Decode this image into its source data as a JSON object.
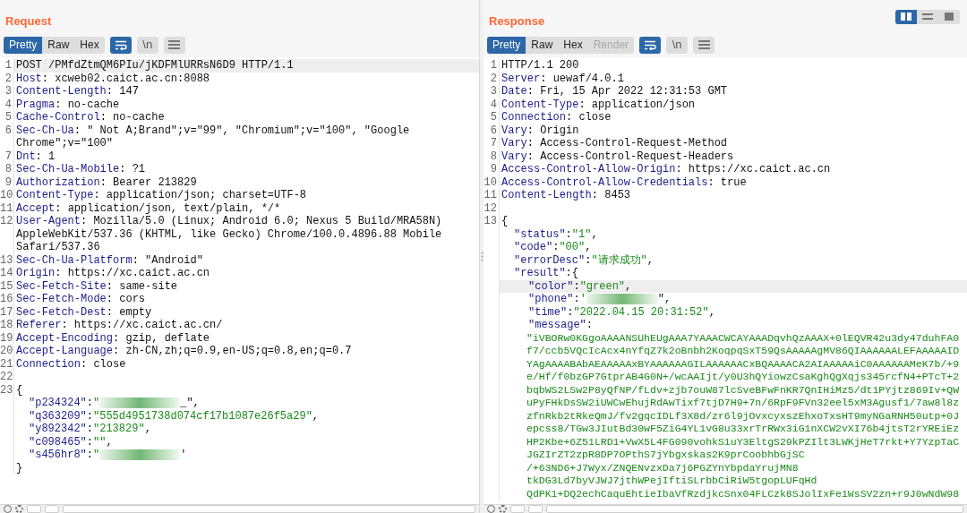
{
  "request": {
    "title": "Request",
    "view_tabs": [
      {
        "label": "Pretty",
        "selected": true,
        "disabled": false
      },
      {
        "label": "Raw",
        "selected": false,
        "disabled": false
      },
      {
        "label": "Hex",
        "selected": false,
        "disabled": false
      }
    ],
    "tools": [
      {
        "kind": "wrap",
        "selected": true
      },
      {
        "kind": "newline",
        "label": "\\n",
        "selected": false
      },
      {
        "kind": "menu",
        "selected": false
      }
    ],
    "lines": [
      {
        "num": "1",
        "kind": "plain",
        "text": "POST /PMfdZtmQM6PIu/jKDFMlURRsN6D9 HTTP/1.1",
        "highlighted": true
      },
      {
        "num": "2",
        "kind": "header",
        "name": "Host",
        "sep": ":",
        "value": "xcweb02.caict.ac.cn:8088",
        "highlighted": false
      },
      {
        "num": "3",
        "kind": "header",
        "name": "Content-Length",
        "sep": ":",
        "value": "147",
        "highlighted": false
      },
      {
        "num": "4",
        "kind": "header",
        "name": "Pragma",
        "sep": ":",
        "value": "no-cache",
        "highlighted": false
      },
      {
        "num": "5",
        "kind": "header",
        "name": "Cache-Control",
        "sep": ":",
        "value": "no-cache",
        "highlighted": false
      },
      {
        "num": "6",
        "kind": "header",
        "name": "Sec-Ch-Ua",
        "sep": ":",
        "value": "\" Not A;Brand\";v=\"99\", \"Chromium\";v=\"100\", \"Google Chrome\";v=\"100\"",
        "highlighted": false
      },
      {
        "num": "7",
        "kind": "header",
        "name": "Dnt",
        "sep": ":",
        "value": "1",
        "highlighted": false
      },
      {
        "num": "8",
        "kind": "header",
        "name": "Sec-Ch-Ua-Mobile",
        "sep": ":",
        "value": "?1",
        "highlighted": false
      },
      {
        "num": "9",
        "kind": "header",
        "name": "Authorization",
        "sep": ":",
        "value": "Bearer 213829",
        "highlighted": false
      },
      {
        "num": "10",
        "kind": "header",
        "name": "Content-Type",
        "sep": ":",
        "value": "application/json; charset=UTF-8",
        "highlighted": false
      },
      {
        "num": "11",
        "kind": "header",
        "name": "Accept",
        "sep": ":",
        "value": "application/json, text/plain, */*",
        "highlighted": false
      },
      {
        "num": "12",
        "kind": "header",
        "name": "User-Agent",
        "sep": ":",
        "value": "Mozilla/5.0 (Linux; Android 6.0; Nexus 5 Build/MRA58N) AppleWebKit/537.36 (KHTML, like Gecko) Chrome/100.0.4896.88 Mobile Safari/537.36",
        "highlighted": false
      },
      {
        "num": "13",
        "kind": "header",
        "name": "Sec-Ch-Ua-Platform",
        "sep": ":",
        "value": "\"Android\"",
        "highlighted": false
      },
      {
        "num": "14",
        "kind": "header",
        "name": "Origin",
        "sep": ":",
        "value": "https://xc.caict.ac.cn",
        "highlighted": false
      },
      {
        "num": "15",
        "kind": "header",
        "name": "Sec-Fetch-Site",
        "sep": ":",
        "value": "same-site",
        "highlighted": false
      },
      {
        "num": "16",
        "kind": "header",
        "name": "Sec-Fetch-Mode",
        "sep": ":",
        "value": "cors",
        "highlighted": false
      },
      {
        "num": "17",
        "kind": "header",
        "name": "Sec-Fetch-Dest",
        "sep": ":",
        "value": "empty",
        "highlighted": false
      },
      {
        "num": "18",
        "kind": "header",
        "name": "Referer",
        "sep": ":",
        "value": "https://xc.caict.ac.cn/",
        "highlighted": false
      },
      {
        "num": "19",
        "kind": "header",
        "name": "Accept-Encoding",
        "sep": ":",
        "value": "gzip, deflate",
        "highlighted": false
      },
      {
        "num": "20",
        "kind": "header",
        "name": "Accept-Language",
        "sep": ":",
        "value": "zh-CN,zh;q=0.9,en-US;q=0.8,en;q=0.7",
        "highlighted": false
      },
      {
        "num": "21",
        "kind": "header",
        "name": "Connection",
        "sep": ":",
        "value": "close",
        "highlighted": false
      },
      {
        "num": "22",
        "kind": "blank",
        "highlighted": false
      },
      {
        "num": "23",
        "kind": "plain",
        "text": "{",
        "highlighted": false
      },
      {
        "kind": "field",
        "key": "\"p234324\"",
        "sep": ":",
        "value": "\"",
        "tail": "_\",",
        "redacted": true,
        "highlighted": false
      },
      {
        "kind": "field",
        "key": "\"q363209\"",
        "sep": ":",
        "value": "\"555d4951738d074cf17b1087e26f5a29\"",
        "tail": ",",
        "redacted": false,
        "highlighted": false
      },
      {
        "kind": "field",
        "key": "\"y892342\"",
        "sep": ":",
        "value": "\"213829\"",
        "tail": ",",
        "redacted": false,
        "highlighted": false
      },
      {
        "kind": "field",
        "key": "\"c098465\"",
        "sep": ":",
        "value": "\"\"",
        "tail": ",",
        "redacted": false,
        "highlighted": false
      },
      {
        "kind": "field",
        "key": "\"s456hr8\"",
        "sep": ":",
        "value": "\"",
        "tail": "'",
        "redacted": true,
        "highlighted": false
      },
      {
        "kind": "plain",
        "text": "}",
        "highlighted": false
      }
    ]
  },
  "response": {
    "title": "Response",
    "view_tabs": [
      {
        "label": "Pretty",
        "selected": true,
        "disabled": false
      },
      {
        "label": "Raw",
        "selected": false,
        "disabled": false
      },
      {
        "label": "Hex",
        "selected": false,
        "disabled": false
      },
      {
        "label": "Render",
        "selected": false,
        "disabled": true
      }
    ],
    "tools": [
      {
        "kind": "wrap",
        "selected": true
      },
      {
        "kind": "newline",
        "label": "\\n",
        "selected": false
      },
      {
        "kind": "menu",
        "selected": false
      }
    ],
    "layout_buttons": [
      {
        "kind": "columns",
        "selected": true
      },
      {
        "kind": "rows",
        "selected": false
      },
      {
        "kind": "single",
        "selected": false
      }
    ],
    "lines": [
      {
        "num": "1",
        "kind": "plain",
        "text": "HTTP/1.1 200",
        "highlighted": false
      },
      {
        "num": "2",
        "kind": "header",
        "name": "Server",
        "sep": ":",
        "value": "uewaf/4.0.1",
        "highlighted": false
      },
      {
        "num": "3",
        "kind": "header",
        "name": "Date",
        "sep": ":",
        "value": "Fri, 15 Apr 2022 12:31:53 GMT",
        "highlighted": false
      },
      {
        "num": "4",
        "kind": "header",
        "name": "Content-Type",
        "sep": ":",
        "value": "application/json",
        "highlighted": false
      },
      {
        "num": "5",
        "kind": "header",
        "name": "Connection",
        "sep": ":",
        "value": "close",
        "highlighted": false
      },
      {
        "num": "6",
        "kind": "header",
        "name": "Vary",
        "sep": ":",
        "value": "Origin",
        "highlighted": false
      },
      {
        "num": "7",
        "kind": "header",
        "name": "Vary",
        "sep": ":",
        "value": "Access-Control-Request-Method",
        "highlighted": false
      },
      {
        "num": "8",
        "kind": "header",
        "name": "Vary",
        "sep": ":",
        "value": "Access-Control-Request-Headers",
        "highlighted": false
      },
      {
        "num": "9",
        "kind": "header",
        "name": "Access-Control-Allow-Origin",
        "sep": ":",
        "value": "https://xc.caict.ac.cn",
        "highlighted": false
      },
      {
        "num": "10",
        "kind": "header",
        "name": "Access-Control-Allow-Credentials",
        "sep": ":",
        "value": "true",
        "highlighted": false
      },
      {
        "num": "11",
        "kind": "header",
        "name": "Content-Length",
        "sep": ":",
        "value": "8453",
        "highlighted": false
      },
      {
        "num": "12",
        "kind": "blank",
        "highlighted": false
      },
      {
        "num": "13",
        "kind": "plain",
        "text": "{",
        "highlighted": false
      },
      {
        "kind": "field",
        "key": "\"status\"",
        "sep": ":",
        "value": "\"1\"",
        "tail": ",",
        "redacted": false,
        "highlighted": false
      },
      {
        "kind": "field",
        "key": "\"code\"",
        "sep": ":",
        "value": "\"00\"",
        "tail": ",",
        "redacted": false,
        "highlighted": false
      },
      {
        "kind": "field",
        "key": "\"errorDesc\"",
        "sep": ":",
        "value": "\"请求成功\"",
        "tail": ",",
        "redacted": false,
        "highlighted": false
      },
      {
        "kind": "open",
        "key": "\"result\"",
        "sep": ":",
        "text": "{",
        "highlighted": false
      },
      {
        "kind": "field",
        "nested": true,
        "key": "\"color\"",
        "sep": ":",
        "value": "\"green\"",
        "tail": ",",
        "redacted": false,
        "highlighted": true
      },
      {
        "kind": "field",
        "nested": true,
        "key": "\"phone\"",
        "sep": ":",
        "value": "'",
        "tail": "\",",
        "redacted": true,
        "highlighted": false
      },
      {
        "kind": "field",
        "nested": true,
        "key": "\"time\"",
        "sep": ":",
        "value": "\"2022.04.15 20:31:52\"",
        "tail": ",",
        "redacted": false,
        "highlighted": false
      },
      {
        "kind": "open",
        "nested": true,
        "key": "\"message\"",
        "sep": ":",
        "highlighted": false
      }
    ],
    "message_lines": [
      "\"iVBORw0KGgoAAAANSUhEUgAAA7YAAACWCAYAAADqvhQzAAAX+0lEQVR42u3dy47duhFA0",
      "f7/ccb5VQcIcAcx4nYfqZ7k2oBnbh2KoqpqSxT59QsAAAAAgMV86QIAAAAAALEFAAAAAID",
      "YAgAAAABAbAEAAAAAxBYAAAAAAGILAAAAAACxBQAAAACA2AIAAAAAiC0AAAAAAMeK7b/+9",
      "e/Hf/f0bzGP7GtprAB4G0N+/wcAAIjt/y0U3hQYiowzCsaKghQgXqjs345rcfN4+PTcT+2",
      "bqbWS2LSw2P8yQfNP/fLdv+zjb7ouW87lcSveBFwFnKR7QnIHiMz5/dt1PYjtz869Iv+QW",
      "uPyFHkDsSW2iUWCwEhujRdAwTixf7tjD7H9+7n/6RpF9FVn32eel5xM3Agusf1/7aw8l8z",
      "zfnRkb2tRkeQmJ/fv2gqcIDLf3X8d/zr6l9jOvxcyxszEhxoTxsHT9myNGaRNH50utp+0J",
      "epcss8/TGw3JIutBd30wF5ZiG4YL1vG8u33xrTrRWx3iG1nXCW2vXI76b4jtsT2rYREiEz",
      "HP2Kbe+6Z51LRD1+VwX5L4FG090vohkS1uY3EltgS29kPZIlt3LWKjHeT7rkt+Y7YzpTaC",
      "JGZIrZT2zpR8DP7OPthS7jYbgxskas2K9prCoobhbGjSC",
      "/+63ND6+J7Wyx/ZNQENvzxDa7j6PGZYnYbpdaYrujMN8",
      "tkDG3Ld7byVJWJ7jthWPejIftiSLrbbCiRiW5tgopLUFqHd",
      "QdPK1+DQ2echCaquEhtieIbaVfRzdjkcSnx04FLCzk8SJolIxFe1WsSV2zn+r9J0wNdW98"
    ]
  }
}
